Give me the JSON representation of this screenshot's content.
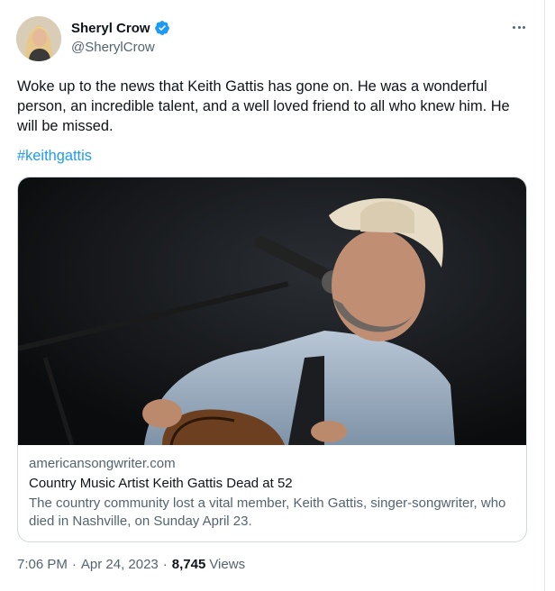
{
  "author": {
    "display_name": "Sheryl Crow",
    "handle": "@SherylCrow",
    "verified_icon": "verified-badge-icon",
    "verified_color": "#1d9bf0"
  },
  "tweet": {
    "text": "Woke up to the news that Keith Gattis has gone on. He was a wonderful person, an incredible talent, and a well loved friend to all who knew him. He will be missed.",
    "hashtag": "#keithgattis"
  },
  "card": {
    "domain": "americansongwriter.com",
    "title": "Country Music Artist Keith Gattis Dead at 52",
    "description": "The country community lost a vital member, Keith Gattis, singer-songwriter, who died in Nashville, on Sunday April 23."
  },
  "meta": {
    "time": "7:06 PM",
    "date": "Apr 24, 2023",
    "separator": "·",
    "views_count": "8,745",
    "views_label": "Views"
  },
  "colors": {
    "link": "#1d9bf0",
    "secondary_text": "#536471",
    "border": "#cfd9de"
  }
}
